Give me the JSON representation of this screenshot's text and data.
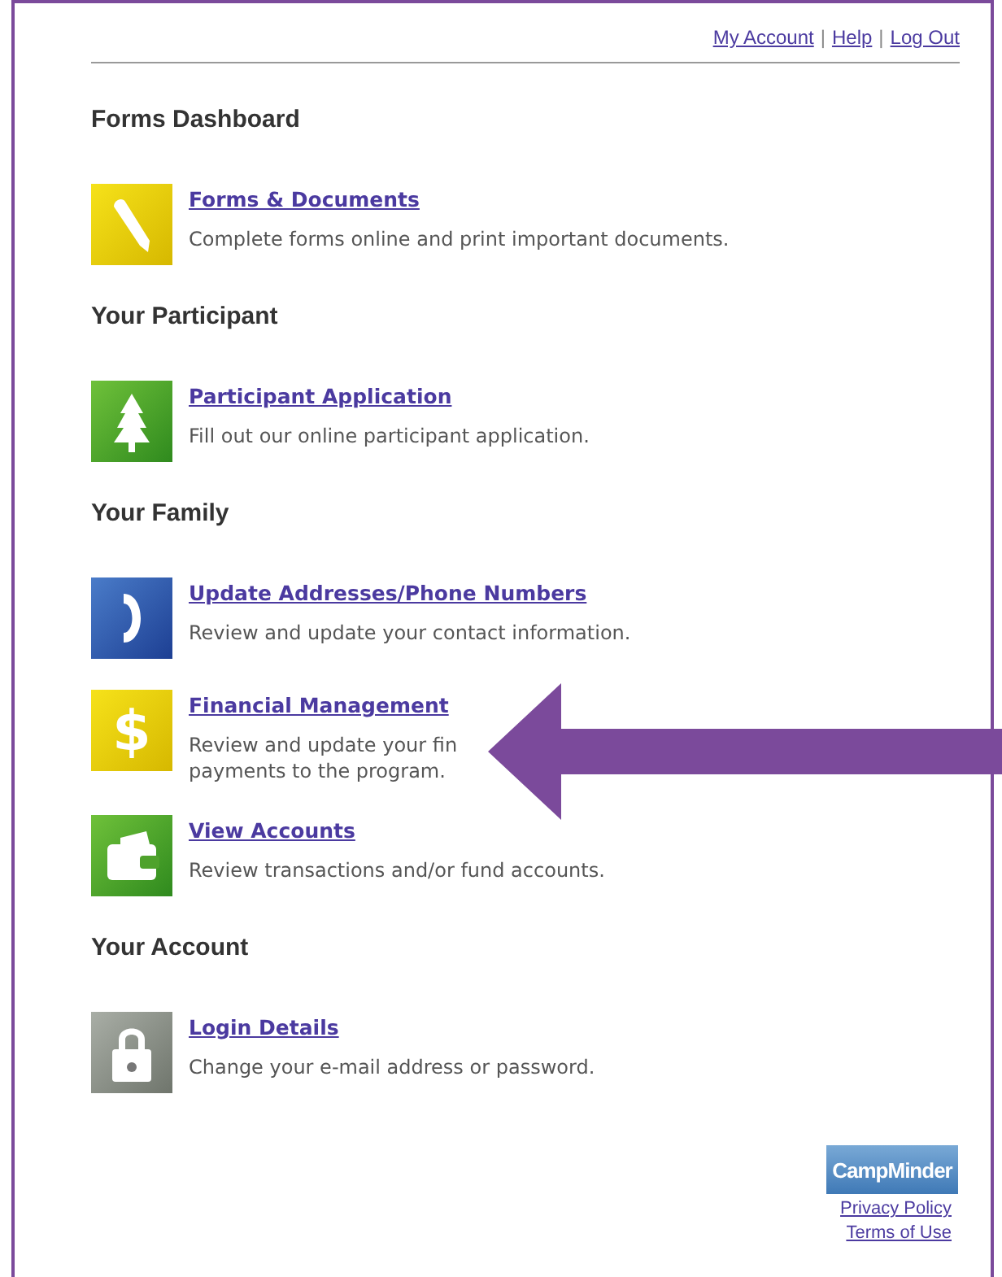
{
  "account_links": {
    "separator": "|",
    "links": [
      {
        "label": "My Account"
      },
      {
        "label": "Help"
      },
      {
        "label": "Log Out"
      }
    ]
  },
  "sections": [
    {
      "heading": "Forms Dashboard",
      "items": [
        {
          "kind": "pencil",
          "title": "Forms & Documents",
          "description": [
            "Complete forms online and print important documents."
          ]
        }
      ]
    },
    {
      "heading": "Your Participant",
      "items": [
        {
          "kind": "tree",
          "title": "Participant Application",
          "description": [
            "Fill out our online participant application."
          ]
        }
      ]
    },
    {
      "heading": "Your Family",
      "items": [
        {
          "kind": "phone",
          "title": "Update Addresses/Phone Numbers",
          "description": [
            "Review and update your contact information."
          ]
        },
        {
          "kind": "dollar",
          "glyph": "$",
          "title": "Financial Management",
          "description": [
            "Review and update your fin",
            "payments to the program."
          ]
        },
        {
          "kind": "wallet",
          "title": "View Accounts",
          "description": [
            "Review transactions and/or fund accounts."
          ]
        }
      ]
    },
    {
      "heading": "Your Account",
      "items": [
        {
          "kind": "lock",
          "title": "Login Details",
          "description": [
            "Change your e-mail address or password."
          ]
        }
      ]
    }
  ],
  "footer": {
    "logo": "CampMinder",
    "links": [
      {
        "label": "Privacy Policy"
      },
      {
        "label": "Terms of Use"
      }
    ]
  }
}
